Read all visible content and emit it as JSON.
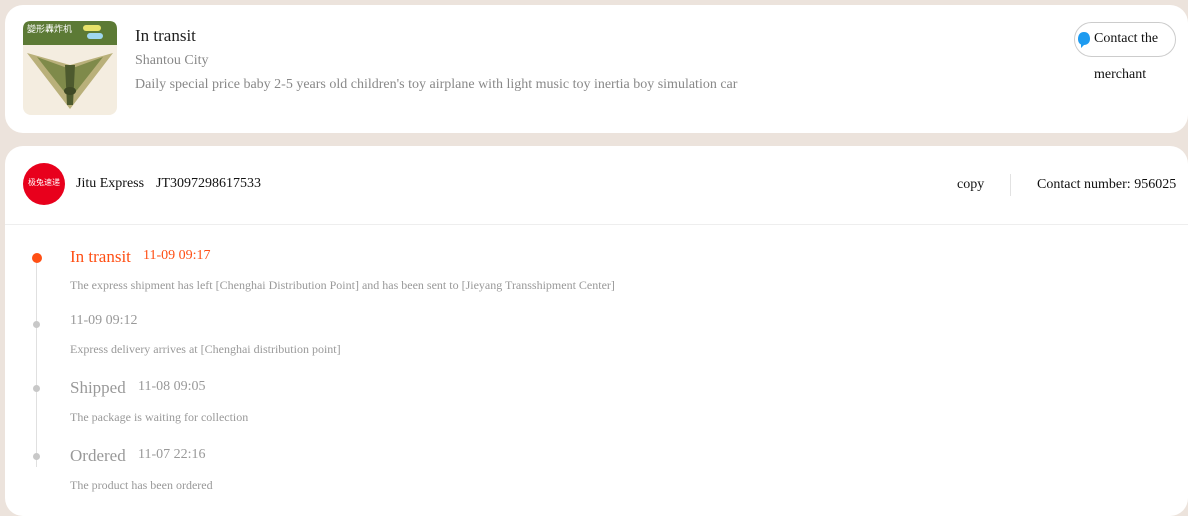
{
  "order": {
    "status": "In transit",
    "city": "Shantou City",
    "product_title": "Daily special price baby 2-5 years old children's toy airplane with light music toy inertia boy simulation car",
    "contact_button_line1": "Contact the",
    "contact_button_line2": "merchant",
    "thumbnail_banner_text": "變形轟炸机"
  },
  "shipping": {
    "logo_text": "极兔速递",
    "carrier": "Jitu Express",
    "tracking_number": "JT3097298617533",
    "copy_label": "copy",
    "contact_number": "Contact number: 956025"
  },
  "timeline": [
    {
      "title": "In transit",
      "time": "11-09 09:17",
      "desc": "The express shipment has left [Chenghai Distribution Point] and has been sent to [Jieyang Transshipment Center]",
      "active": true
    },
    {
      "title": "",
      "time": "11-09 09:12",
      "desc": "Express delivery arrives at [Chenghai distribution point]",
      "active": false
    },
    {
      "title": "Shipped",
      "time": "11-08 09:05",
      "desc": "The package is waiting for collection",
      "active": false
    },
    {
      "title": "Ordered",
      "time": "11-07 22:16",
      "desc": "The product has been ordered",
      "active": false
    }
  ],
  "colors": {
    "accent": "#ff4f14",
    "logo_red": "#e8001c",
    "background": "#ece3dc"
  }
}
